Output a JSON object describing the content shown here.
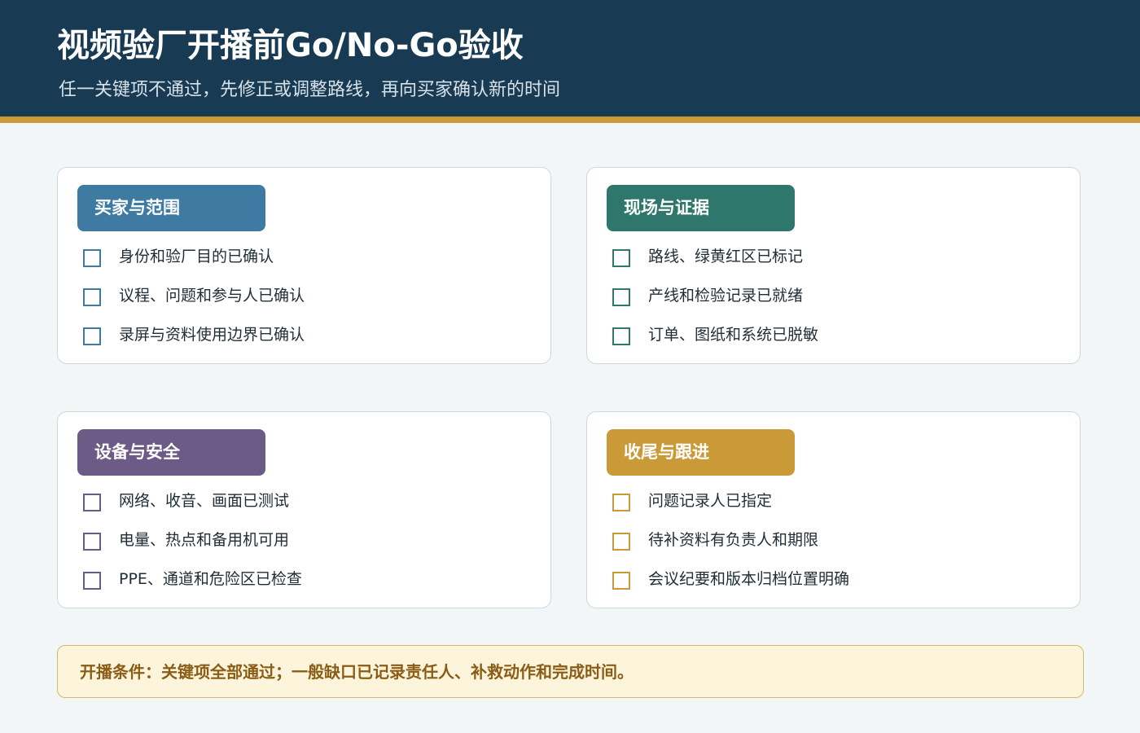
{
  "header": {
    "title": "视频验厂开播前Go/No-Go验收",
    "subtitle": "任一关键项不通过，先修正或调整路线，再向买家确认新的时间"
  },
  "colors": {
    "header_bg": "#183a52",
    "header_rule": "#c99a37",
    "page_bg": "#f3f6f7",
    "buyer_scope": "#3e7aa1",
    "site_evidence": "#2f776c",
    "equipment_safety": "#6b5b86",
    "wrap_up": "#c99a37",
    "footer_bg": "#fdf4dc",
    "footer_text": "#8a5d14"
  },
  "sections": {
    "buyer_scope": {
      "title": "买家与范围",
      "items": [
        "身份和验厂目的已确认",
        "议程、问题和参与人已确认",
        "录屏与资料使用边界已确认"
      ]
    },
    "site_evidence": {
      "title": "现场与证据",
      "items": [
        "路线、绿黄红区已标记",
        "产线和检验记录已就绪",
        "订单、图纸和系统已脱敏"
      ]
    },
    "equipment_safety": {
      "title": "设备与安全",
      "items": [
        "网络、收音、画面已测试",
        "电量、热点和备用机可用",
        "PPE、通道和危险区已检查"
      ]
    },
    "wrap_up": {
      "title": "收尾与跟进",
      "items": [
        "问题记录人已指定",
        "待补资料有负责人和期限",
        "会议纪要和版本归档位置明确"
      ]
    }
  },
  "footer": {
    "note": "开播条件：关键项全部通过；一般缺口已记录责任人、补救动作和完成时间。"
  }
}
